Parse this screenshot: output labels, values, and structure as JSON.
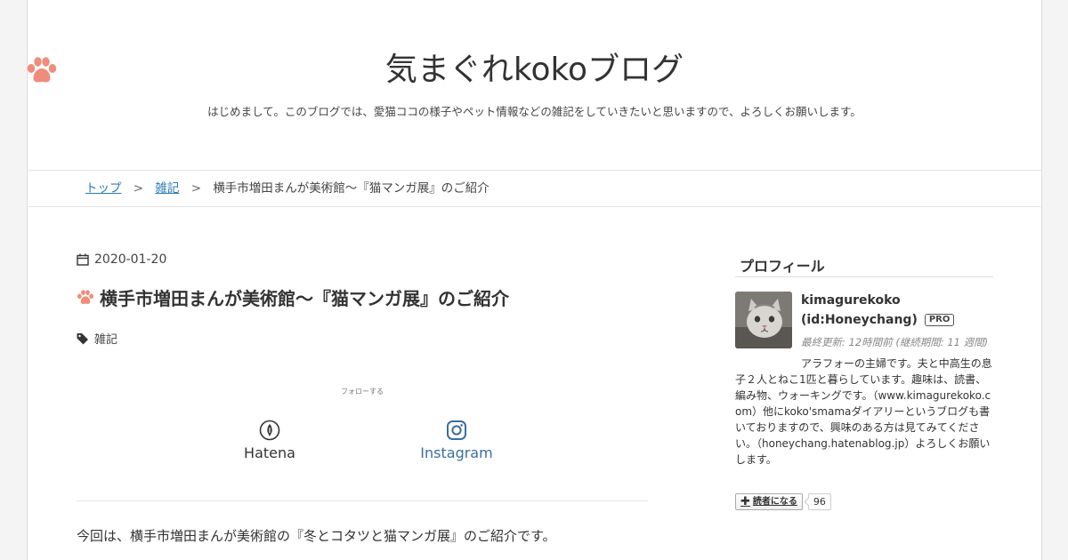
{
  "header": {
    "blog_title": "気まぐれkokoブログ",
    "description": "はじめまして。このブログでは、愛猫ココの様子やペット情報などの雑記をしていきたいと思いますので、よろしくお願いします。"
  },
  "breadcrumb": {
    "top": "トップ",
    "separator": ">",
    "category": "雑記",
    "current": "横手市増田まんが美術館〜『猫マンガ展』のご紹介"
  },
  "entry": {
    "date": "2020-01-20",
    "title": "横手市増田まんが美術館〜『猫マンガ展』のご紹介",
    "category": "雑記",
    "follow_label": "フォローする",
    "follow_hatena": "Hatena",
    "follow_instagram": "Instagram",
    "intro": "今回は、横手市増田まんが美術館の『冬とコタツと猫マンガ展』のご紹介です。"
  },
  "sidebar": {
    "heading": "プロフィール",
    "name": "kimagurekoko",
    "id": "(id:Honeychang)",
    "badge": "PRO",
    "last_updated": "最終更新: 12時間前 (継続期間: 11 週間)",
    "bio": "アラフォーの主婦です。夫と中高生の息子２人とねこ1匹と暮らしています。趣味は、読書、編み物、ウォーキングです。（www.kimagurekoko.com）他にkoko'smamaダイアリーというブログも書いておりますので、興味のある方は見てみてください。（honeychang.hatenablog.jp）よろしくお願いします。",
    "reader_button": "読者になる",
    "reader_count": "96"
  },
  "colors": {
    "paw": "#f08c7a",
    "link": "#2b7bb9",
    "instagram": "#3a6f9f"
  },
  "icons": {
    "decor": "paw-icon",
    "date": "calendar-icon",
    "category": "tag-icon",
    "hatena": "hatena-icon",
    "instagram": "instagram-icon"
  }
}
